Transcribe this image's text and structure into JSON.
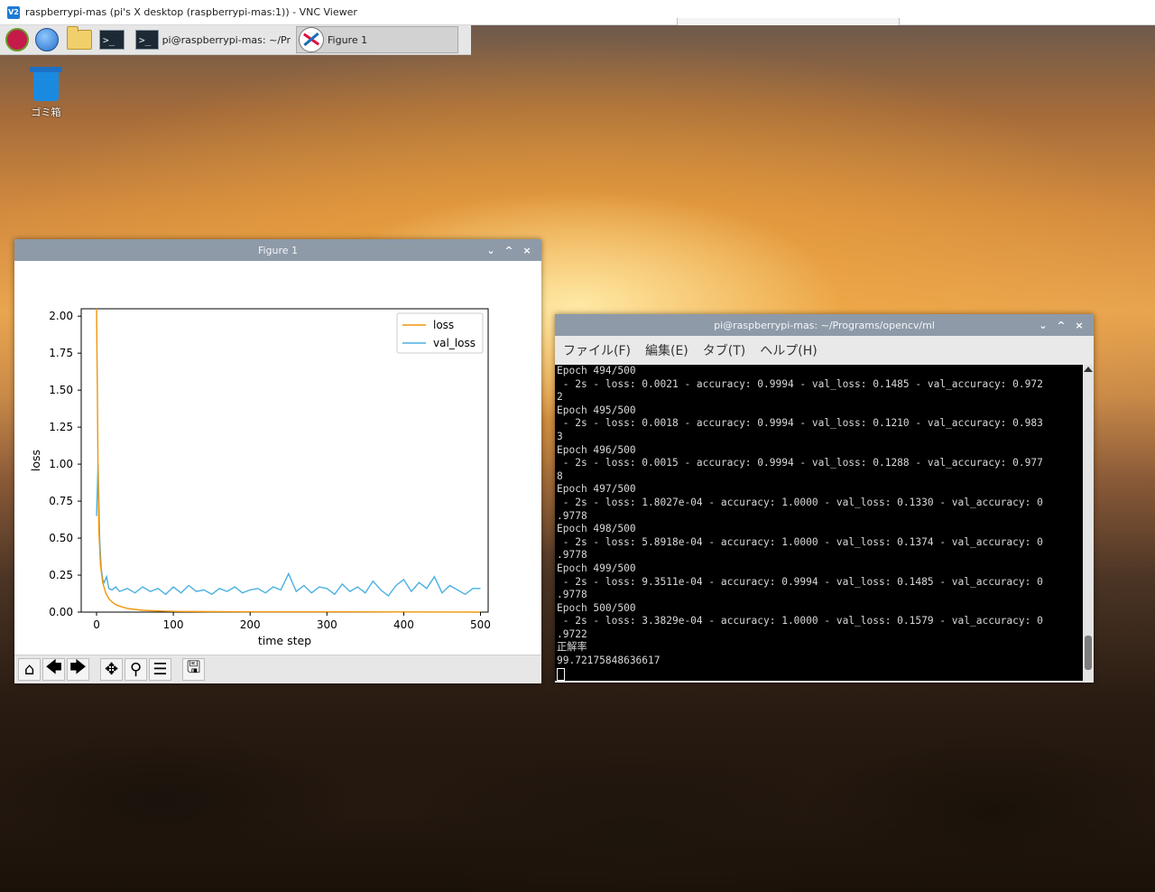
{
  "vnc": {
    "title": "raspberrypi-mas (pi's X desktop (raspberrypi-mas:1)) - VNC Viewer",
    "logo": "V2"
  },
  "taskbar": {
    "icons": [
      "raspberry-pi-menu-icon",
      "web-browser-icon",
      "file-manager-icon",
      "terminal-icon"
    ],
    "terminal_glyph": ">_",
    "tasks": [
      {
        "label": "pi@raspberrypi-mas: ~/Pro...",
        "icon": "terminal-icon"
      },
      {
        "label": "Figure 1",
        "icon": "figure-app-icon"
      }
    ]
  },
  "desktop": {
    "trash_label": "ゴミ箱"
  },
  "figure_window": {
    "title": "Figure 1",
    "controls": [
      "⌄",
      "^",
      "×"
    ],
    "toolbar": [
      {
        "name": "home-icon",
        "glyph": "⌂"
      },
      {
        "name": "back-arrow-icon",
        "glyph": "🡄"
      },
      {
        "name": "forward-arrow-icon",
        "glyph": "🡆"
      },
      {
        "name": "pan-icon",
        "glyph": "✥"
      },
      {
        "name": "zoom-icon",
        "glyph": "⚲"
      },
      {
        "name": "configure-subplots-icon",
        "glyph": "☰"
      },
      {
        "name": "save-icon",
        "glyph": "🖫"
      }
    ]
  },
  "chart_data": {
    "type": "line",
    "xlabel": "time step",
    "ylabel": "loss",
    "xlim": [
      -20,
      510
    ],
    "ylim": [
      0,
      2.05
    ],
    "xticks": [
      0,
      100,
      200,
      300,
      400,
      500
    ],
    "yticks": [
      "0.00",
      "0.25",
      "0.50",
      "0.75",
      "1.00",
      "1.25",
      "1.50",
      "1.75",
      "2.00"
    ],
    "legend_position": "top-right",
    "series": [
      {
        "name": "loss",
        "color": "#f0960a",
        "x": [
          0,
          1,
          2,
          3,
          5,
          8,
          12,
          16,
          20,
          25,
          30,
          40,
          50,
          60,
          80,
          100,
          150,
          200,
          300,
          400,
          500
        ],
        "values": [
          2.05,
          1.5,
          0.9,
          0.55,
          0.32,
          0.2,
          0.13,
          0.09,
          0.07,
          0.05,
          0.04,
          0.025,
          0.018,
          0.012,
          0.008,
          0.005,
          0.003,
          0.002,
          0.002,
          0.001,
          0.0003
        ]
      },
      {
        "name": "val_loss",
        "color": "#4ab0e0",
        "x": [
          0,
          2,
          4,
          6,
          8,
          10,
          13,
          16,
          20,
          25,
          30,
          40,
          50,
          60,
          70,
          80,
          90,
          100,
          110,
          120,
          130,
          140,
          150,
          160,
          170,
          180,
          190,
          200,
          210,
          220,
          230,
          240,
          250,
          260,
          270,
          280,
          290,
          300,
          310,
          320,
          330,
          340,
          350,
          360,
          370,
          380,
          390,
          400,
          410,
          420,
          430,
          440,
          450,
          460,
          470,
          480,
          490,
          500
        ],
        "values": [
          0.65,
          1.0,
          0.5,
          0.3,
          0.22,
          0.2,
          0.24,
          0.16,
          0.15,
          0.17,
          0.14,
          0.16,
          0.13,
          0.17,
          0.14,
          0.16,
          0.12,
          0.17,
          0.13,
          0.18,
          0.14,
          0.15,
          0.12,
          0.16,
          0.14,
          0.17,
          0.13,
          0.15,
          0.16,
          0.13,
          0.17,
          0.15,
          0.26,
          0.14,
          0.18,
          0.13,
          0.17,
          0.16,
          0.12,
          0.19,
          0.14,
          0.17,
          0.13,
          0.21,
          0.15,
          0.11,
          0.18,
          0.22,
          0.14,
          0.2,
          0.16,
          0.24,
          0.13,
          0.18,
          0.15,
          0.12,
          0.16,
          0.16
        ]
      }
    ]
  },
  "terminal_window": {
    "title": "pi@raspberrypi-mas: ~/Programs/opencv/ml",
    "controls": [
      "⌄",
      "^",
      "×"
    ],
    "menu": [
      "ファイル(F)",
      "編集(E)",
      "タブ(T)",
      "ヘルプ(H)"
    ],
    "lines": [
      "Epoch 494/500",
      " - 2s - loss: 0.0021 - accuracy: 0.9994 - val_loss: 0.1485 - val_accuracy: 0.972",
      "2",
      "Epoch 495/500",
      " - 2s - loss: 0.0018 - accuracy: 0.9994 - val_loss: 0.1210 - val_accuracy: 0.983",
      "3",
      "Epoch 496/500",
      " - 2s - loss: 0.0015 - accuracy: 0.9994 - val_loss: 0.1288 - val_accuracy: 0.977",
      "8",
      "Epoch 497/500",
      " - 2s - loss: 1.8027e-04 - accuracy: 1.0000 - val_loss: 0.1330 - val_accuracy: 0",
      ".9778",
      "Epoch 498/500",
      " - 2s - loss: 5.8918e-04 - accuracy: 1.0000 - val_loss: 0.1374 - val_accuracy: 0",
      ".9778",
      "Epoch 499/500",
      " - 2s - loss: 9.3511e-04 - accuracy: 0.9994 - val_loss: 0.1485 - val_accuracy: 0",
      ".9778",
      "Epoch 500/500",
      " - 2s - loss: 3.3829e-04 - accuracy: 1.0000 - val_loss: 0.1579 - val_accuracy: 0",
      ".9722",
      "正解率",
      "99.72175848636617"
    ]
  }
}
